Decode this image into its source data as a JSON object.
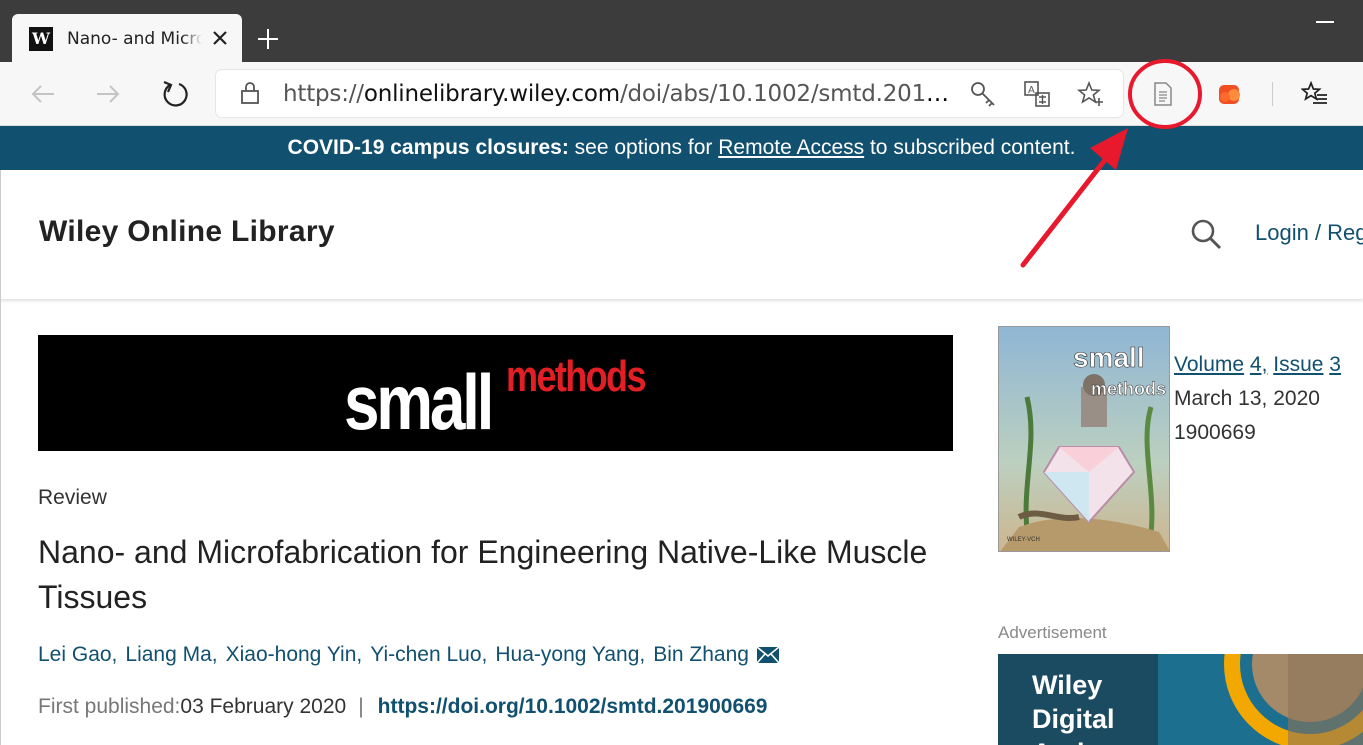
{
  "browser": {
    "tab": {
      "favicon_letter": "W",
      "title": "Nano- and Microfabrication for Engineering Native-Like Muscle Tissues"
    },
    "url": {
      "prefix": "https://",
      "host": "onlinelibrary.wiley.com",
      "path": "/doi/abs/10.1002/smtd.201900..."
    }
  },
  "banner": {
    "bold": "COVID-19 campus closures:",
    "text_before": " see options for ",
    "link": "Remote Access",
    "text_after": " to subscribed content."
  },
  "site": {
    "logo": "Wiley Online Library",
    "login": "Login / Register"
  },
  "journal_banner": {
    "word1": "small",
    "word2": "methods"
  },
  "article": {
    "type": "Review",
    "title": "Nano- and Microfabrication for Engineering Native-Like Muscle Tissues",
    "authors": [
      "Lei Gao,",
      "Liang Ma,",
      "Xiao-hong Yin,",
      "Yi-chen Luo,",
      "Hua-yong Yang,",
      "Bin Zhang"
    ],
    "first_published_label": "First published:",
    "first_published_date": "03 February 2020",
    "doi": "https://doi.org/10.1002/smtd.201900669"
  },
  "issue": {
    "volume_label": "Volume",
    "volume": "4,",
    "issue_label": "Issue",
    "issue": "3",
    "date": "March 13, 2020",
    "article_number": "1900669",
    "cover_title_1": "small",
    "cover_title_2": "methods",
    "cover_publisher": "WILEY-VCH"
  },
  "sidebar": {
    "ad_label": "Advertisement",
    "ad_line1": "Wiley",
    "ad_line2": "Digital",
    "ad_line3": "Arch"
  },
  "colors": {
    "brand": "#11506f",
    "annotation": "#e8192c"
  }
}
